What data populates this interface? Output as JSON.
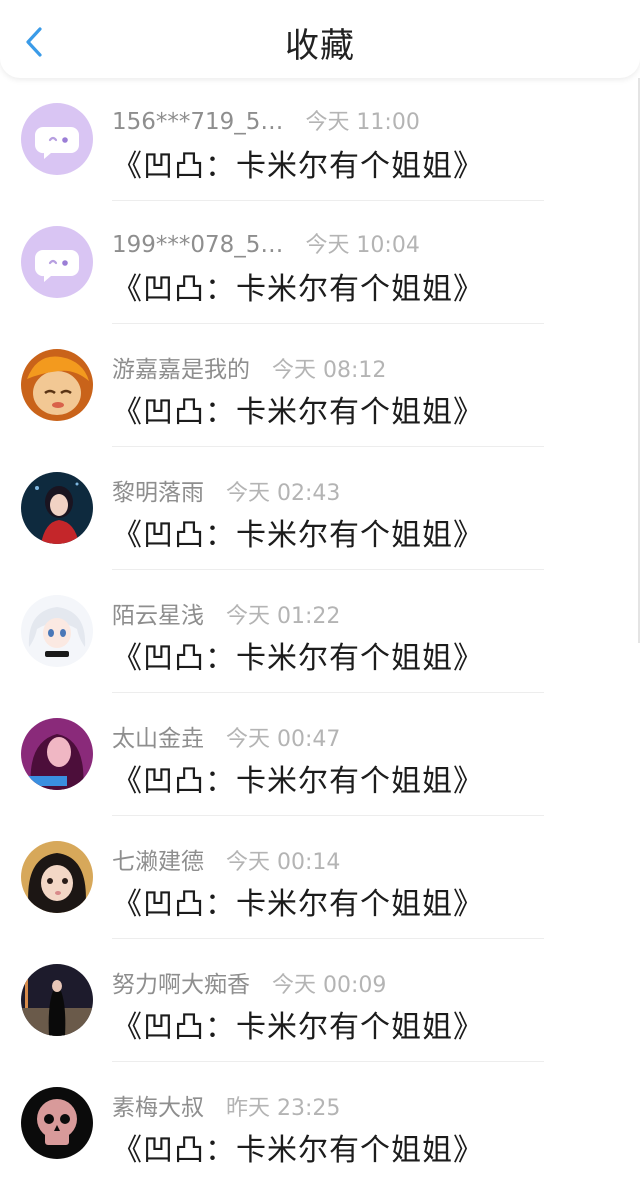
{
  "header": {
    "title": "收藏"
  },
  "items": [
    {
      "name": "156***719_5…",
      "time": "今天 11:00",
      "text": "《凹凸：卡米尔有个姐姐》"
    },
    {
      "name": "199***078_5…",
      "time": "今天 10:04",
      "text": "《凹凸：卡米尔有个姐姐》"
    },
    {
      "name": "游嘉嘉是我的",
      "time": "今天 08:12",
      "text": "《凹凸：卡米尔有个姐姐》"
    },
    {
      "name": "黎明落雨",
      "time": "今天 02:43",
      "text": "《凹凸：卡米尔有个姐姐》"
    },
    {
      "name": "陌云星浅",
      "time": "今天 01:22",
      "text": "《凹凸：卡米尔有个姐姐》"
    },
    {
      "name": "太山金垚",
      "time": "今天 00:47",
      "text": "《凹凸：卡米尔有个姐姐》"
    },
    {
      "name": "七濑建德",
      "time": "今天 00:14",
      "text": "《凹凸：卡米尔有个姐姐》"
    },
    {
      "name": "努力啊大痴香",
      "time": "今天 00:09",
      "text": "《凹凸：卡米尔有个姐姐》"
    },
    {
      "name": "素梅大叔",
      "time": "昨天 23:25",
      "text": "《凹凸：卡米尔有个姐姐》"
    }
  ],
  "colors": {
    "accent": "#3a9be8",
    "default_avatar": "#d9c5f3"
  }
}
